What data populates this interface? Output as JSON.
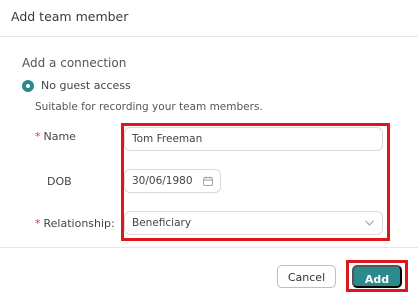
{
  "dialog": {
    "title": "Add team member"
  },
  "connection": {
    "section_label": "Add a connection",
    "option_label": "No guest access",
    "option_selected": true,
    "option_description": "Suitable for recording your team members."
  },
  "form": {
    "name": {
      "required_mark": "*",
      "label": "Name",
      "value": "Tom Freeman"
    },
    "dob": {
      "label": "DOB",
      "value": "30/06/1980",
      "icon": "calendar-icon"
    },
    "relationship": {
      "required_mark": "*",
      "label": "Relationship:",
      "value": "Beneficiary",
      "icon": "chevron-down-icon"
    }
  },
  "footer": {
    "cancel_label": "Cancel",
    "add_label": "Add"
  },
  "colors": {
    "accent": "#2b8a8c",
    "highlight": "#e0151c",
    "required": "#d9303a"
  }
}
